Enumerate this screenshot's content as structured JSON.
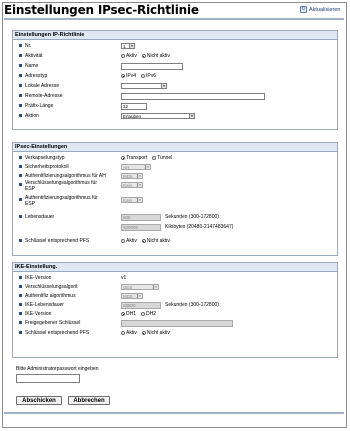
{
  "page": {
    "title": "Einstellungen IPsec-Richtlinie",
    "refresh_label": "Aktualisieren"
  },
  "policy": {
    "heading": "Einstellungen IP-Richtlinie",
    "no_label": "Nr.",
    "no_value": "1",
    "activity_label": "Aktivität",
    "activity_options": [
      "Aktiv",
      "Nicht aktiv"
    ],
    "activity_selected": "Nicht aktiv",
    "name_label": "Name",
    "name_value": "",
    "address_type_label": "Adresstyp",
    "address_type_options": [
      "IPv4",
      "IPv6"
    ],
    "address_type_selected": "IPv4",
    "local_address_label": "Lokale Adresse",
    "local_address_value": "",
    "remote_address_label": "Remote-Adresse",
    "remote_address_value": "",
    "prefix_label": "Präfix-Länge",
    "prefix_value": "32",
    "action_label": "Aktion",
    "action_value": "Erlauben"
  },
  "ipsec": {
    "heading": "IPsec-Einstellungen",
    "encap_label": "Verkapselungstyp",
    "encap_options": [
      "Transport",
      "Tunnel"
    ],
    "encap_selected": "Transport",
    "protocol_label": "Sicherheitsprotokoll",
    "protocol_value": "AH",
    "auth_ah_label": "Authentifizierungsalgorithmus für AH",
    "auth_ah_value": "MD5",
    "enc_esp_label": "Verschlüsselungsalgorithmus für ESP",
    "enc_esp_value": "Kein",
    "auth_esp_label": "Authentifizierungsalgorithmus für ESP",
    "auth_esp_value": "Kein",
    "lifetime_label": "Lebensdauer",
    "lifetime_sec_value": "600",
    "lifetime_sec_note": "Sekunden (300-172800)",
    "lifetime_kb_value": "100000",
    "lifetime_kb_note": "Kilobytes (20480-2147483647)",
    "pfs_label": "Schlüssel entsprechend PFS",
    "pfs_options": [
      "Aktiv",
      "Nicht aktiv"
    ],
    "pfs_selected": "Nicht aktiv"
  },
  "ike": {
    "heading": "IKE-Einstellung.",
    "version_label": "IKE-Version",
    "version_value": "v1",
    "enc_label": "Verschlüsselungsalgorit",
    "enc_value": "DES",
    "auth_label": "Authentifiz algorithmus",
    "auth_value": "MD5",
    "lifetime_label": "IKE-Lebensdauer",
    "lifetime_value": "28800",
    "lifetime_note": "Sekunden (300-172800)",
    "ke_version_label": "IKE-Version",
    "ke_options": [
      "DH1",
      "DH2"
    ],
    "ke_selected": "DH1",
    "psk_label": "Freigegebener Schlüssel",
    "psk_value": "",
    "pfs_label": "Schlüssel entsprechend PFS",
    "pfs_options": [
      "Aktiv",
      "Nicht aktiv"
    ],
    "pfs_selected": "Nicht aktiv"
  },
  "footer": {
    "password_label": "Bitte Administratorpasswort eingeben",
    "password_value": "",
    "submit_label": "Abschicken",
    "cancel_label": "Abbrechen"
  }
}
